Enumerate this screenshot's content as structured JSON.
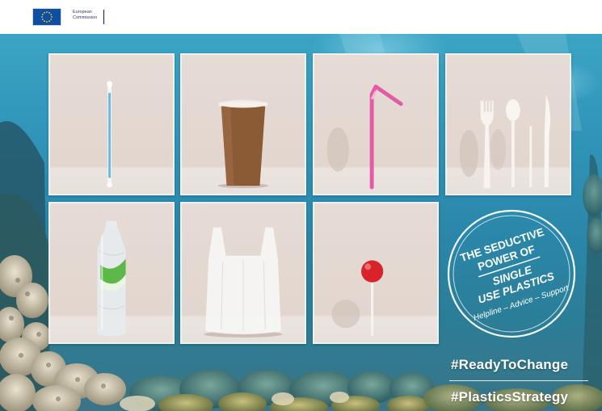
{
  "header": {
    "org_line1": "European",
    "org_line2": "Commission"
  },
  "colors": {
    "ocean": "#2f93b8",
    "tile_bg": "#e4d9d3",
    "tile_border": "#eef1f2",
    "text_white": "#ffffff",
    "eu_blue": "#0e4fa3",
    "eu_gold": "#ffd617"
  },
  "tiles": [
    {
      "item": "cotton-bud-icon"
    },
    {
      "item": "coffee-cup-icon"
    },
    {
      "item": "drinking-straw-icon"
    },
    {
      "item": "cutlery-icon"
    },
    {
      "item": "plastic-bottle-icon"
    },
    {
      "item": "plastic-bag-icon"
    },
    {
      "item": "lollipop-icon"
    }
  ],
  "stamp": {
    "line1": "THE SEDUCTIVE",
    "line2": "POWER OF",
    "line3": "SINGLE",
    "line4": "USE PLASTICS",
    "tagline": "Helpline – Advice – Support"
  },
  "hashtags": {
    "first": "#ReadyToChange",
    "second": "#PlasticsStrategy"
  }
}
